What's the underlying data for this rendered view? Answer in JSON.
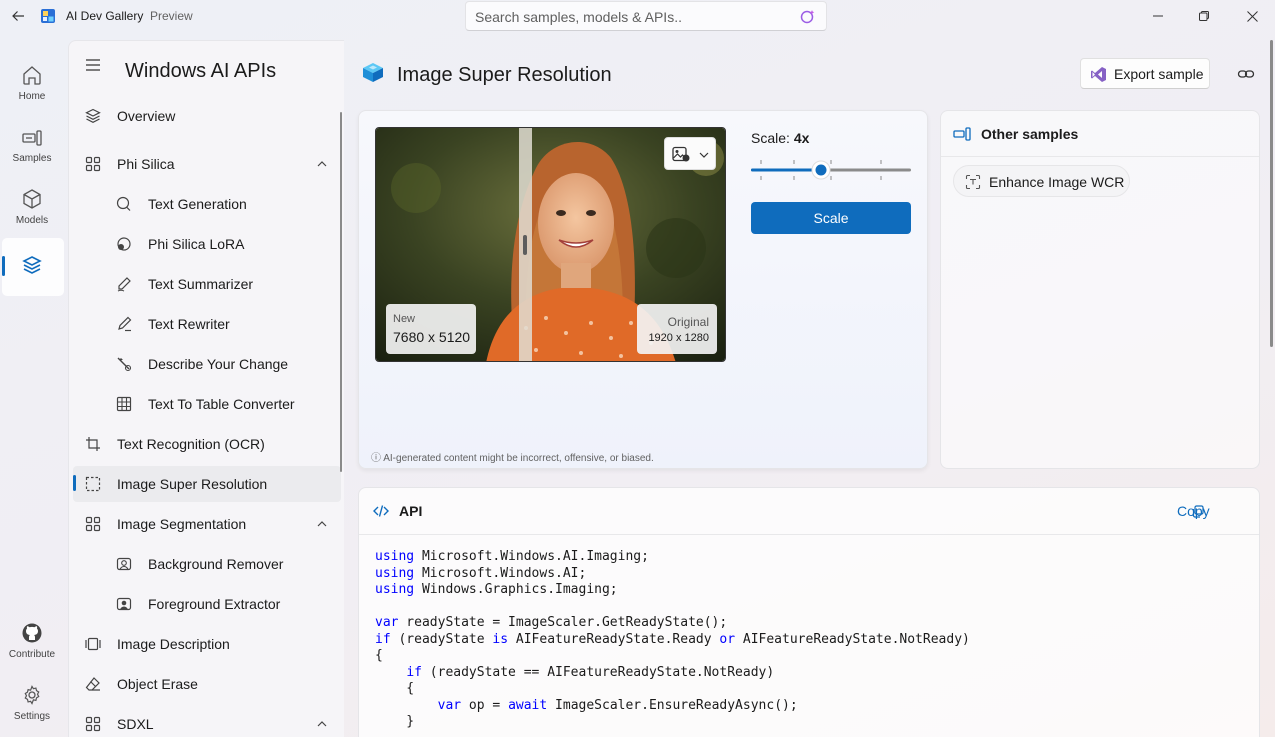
{
  "app": {
    "title": "AI Dev Gallery",
    "subtitle": "Preview",
    "search_placeholder": "Search samples, models & APIs.."
  },
  "rail": {
    "items": [
      {
        "label": "Home",
        "icon": "home-icon"
      },
      {
        "label": "Samples",
        "icon": "samples-icon"
      },
      {
        "label": "Models",
        "icon": "cube-icon"
      },
      {
        "label": "",
        "icon": "layers-icon",
        "active": true
      },
      {
        "label": "Contribute",
        "icon": "github-icon"
      },
      {
        "label": "Settings",
        "icon": "gear-icon"
      }
    ]
  },
  "sidebar": {
    "title": "Windows AI APIs",
    "items": [
      {
        "label": "Overview",
        "icon": "layers-icon"
      },
      {
        "label": "Phi Silica",
        "icon": "grid-icon",
        "expanded": true
      },
      {
        "label": "Text Generation",
        "icon": "chat-icon",
        "sub": true
      },
      {
        "label": "Phi Silica LoRA",
        "icon": "chat-lora-icon",
        "sub": true
      },
      {
        "label": "Text Summarizer",
        "icon": "pen-icon",
        "sub": true
      },
      {
        "label": "Text Rewriter",
        "icon": "rewrite-icon",
        "sub": true
      },
      {
        "label": "Describe Your Change",
        "icon": "wand-icon",
        "sub": true
      },
      {
        "label": "Text To Table Converter",
        "icon": "table-icon",
        "sub": true
      },
      {
        "label": "Text Recognition (OCR)",
        "icon": "crop-icon"
      },
      {
        "label": "Image Super Resolution",
        "icon": "select-icon",
        "active": true
      },
      {
        "label": "Image Segmentation",
        "icon": "grid-icon",
        "expanded": true
      },
      {
        "label": "Background Remover",
        "icon": "bg-remove-icon",
        "sub": true
      },
      {
        "label": "Foreground Extractor",
        "icon": "fg-extract-icon",
        "sub": true
      },
      {
        "label": "Image Description",
        "icon": "image-desc-icon"
      },
      {
        "label": "Object Erase",
        "icon": "eraser-icon"
      },
      {
        "label": "SDXL",
        "icon": "grid-icon",
        "expanded": true
      }
    ]
  },
  "page": {
    "title": "Image Super Resolution",
    "export_label": "Export sample"
  },
  "sample": {
    "scale_label": "Scale:",
    "scale_value": "4x",
    "slider_fraction": 0.44,
    "scale_button": "Scale",
    "new_label": "New",
    "new_size": "7680 x 5120",
    "original_label": "Original",
    "original_size": "1920 x 1280",
    "divider_fraction": 0.43,
    "disclaimer": "ⓘ AI-generated content might be incorrect, offensive, or biased."
  },
  "other": {
    "title": "Other samples",
    "items": [
      {
        "label": "Enhance Image WCR"
      }
    ]
  },
  "api": {
    "title": "API",
    "copy_label": "Copy",
    "code": [
      [
        {
          "k": true,
          "t": "using"
        },
        {
          "t": " Microsoft.Windows.AI.Imaging;"
        }
      ],
      [
        {
          "k": true,
          "t": "using"
        },
        {
          "t": " Microsoft.Windows.AI;"
        }
      ],
      [
        {
          "k": true,
          "t": "using"
        },
        {
          "t": " Windows.Graphics.Imaging;"
        }
      ],
      [],
      [
        {
          "k": true,
          "t": "var"
        },
        {
          "t": " readyState = ImageScaler.GetReadyState();"
        }
      ],
      [
        {
          "k": true,
          "t": "if"
        },
        {
          "t": " (readyState "
        },
        {
          "k": true,
          "t": "is"
        },
        {
          "t": " AIFeatureReadyState.Ready "
        },
        {
          "k": true,
          "t": "or"
        },
        {
          "t": " AIFeatureReadyState.NotReady)"
        }
      ],
      [
        {
          "t": "{"
        }
      ],
      [
        {
          "t": "    "
        },
        {
          "k": true,
          "t": "if"
        },
        {
          "t": " (readyState == AIFeatureReadyState.NotReady)"
        }
      ],
      [
        {
          "t": "    {"
        }
      ],
      [
        {
          "t": "        "
        },
        {
          "k": true,
          "t": "var"
        },
        {
          "t": " op = "
        },
        {
          "k": true,
          "t": "await"
        },
        {
          "t": " ImageScaler.EnsureReadyAsync();"
        }
      ],
      [
        {
          "t": "    }"
        }
      ]
    ]
  }
}
